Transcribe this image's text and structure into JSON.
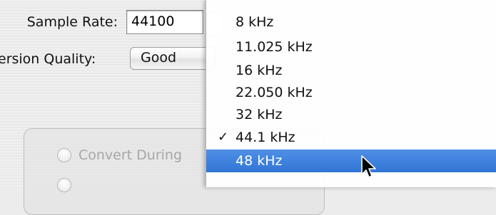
{
  "form": {
    "sample_rate_label": "Sample Rate:",
    "sample_rate_value": "44100",
    "conversion_quality_label": "ersion Quality:",
    "conversion_quality_value": "Good"
  },
  "options_group": {
    "radio_1_label": "Convert During",
    "radio_2_label": ""
  },
  "menu": {
    "items": [
      {
        "label": "8 kHz",
        "checked": false,
        "highlighted": false
      },
      {
        "label": "11.025 kHz",
        "checked": false,
        "highlighted": false
      },
      {
        "label": "16 kHz",
        "checked": false,
        "highlighted": false
      },
      {
        "label": "22.050 kHz",
        "checked": false,
        "highlighted": false
      },
      {
        "label": "32 kHz",
        "checked": false,
        "highlighted": false
      },
      {
        "label": "44.1 kHz",
        "checked": true,
        "highlighted": false
      },
      {
        "label": "48 kHz",
        "checked": false,
        "highlighted": true
      }
    ],
    "check_glyph": "✓",
    "highlight_color": "#3175d6"
  },
  "icons": {
    "cursor": "arrow-cursor-icon"
  }
}
